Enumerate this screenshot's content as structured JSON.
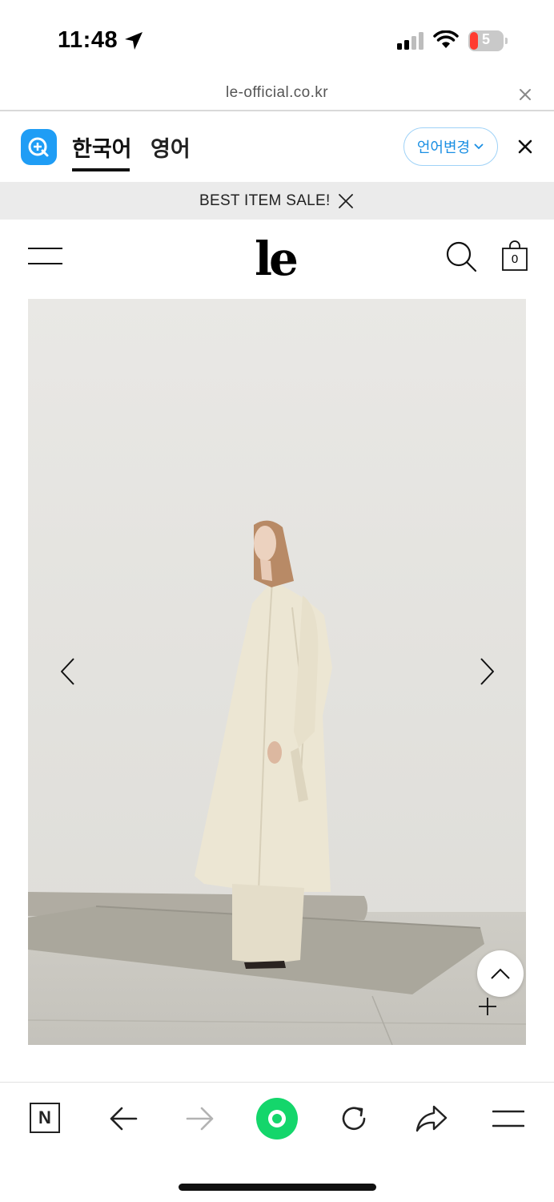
{
  "status_bar": {
    "time": "11:48",
    "battery_level": "5"
  },
  "url_bar": {
    "domain": "le-official.co.kr"
  },
  "translate_bar": {
    "languages": [
      "한국어",
      "영어"
    ],
    "selected_language": "한국어",
    "change_language_label": "언어변경"
  },
  "promo": {
    "text": "BEST ITEM SALE!"
  },
  "site": {
    "logo": "le",
    "cart_count": "0"
  },
  "hero": {
    "description": "Model wearing long cream trench coat standing on a rug"
  },
  "colors": {
    "papago_blue": "#1f9df5",
    "browser_green": "#14d66b",
    "promo_bg": "#ebebeb",
    "battery_red": "#ff3b30"
  },
  "icons": {
    "status": [
      "location-arrow-icon",
      "cellular-signal-icon",
      "wifi-icon",
      "battery-icon"
    ],
    "header": [
      "hamburger-menu-icon",
      "search-icon",
      "shopping-bag-icon"
    ],
    "toolbar": [
      "naver-n-icon",
      "back-arrow-icon",
      "forward-arrow-icon",
      "green-home-icon",
      "reload-icon",
      "share-icon",
      "menu-icon"
    ]
  }
}
